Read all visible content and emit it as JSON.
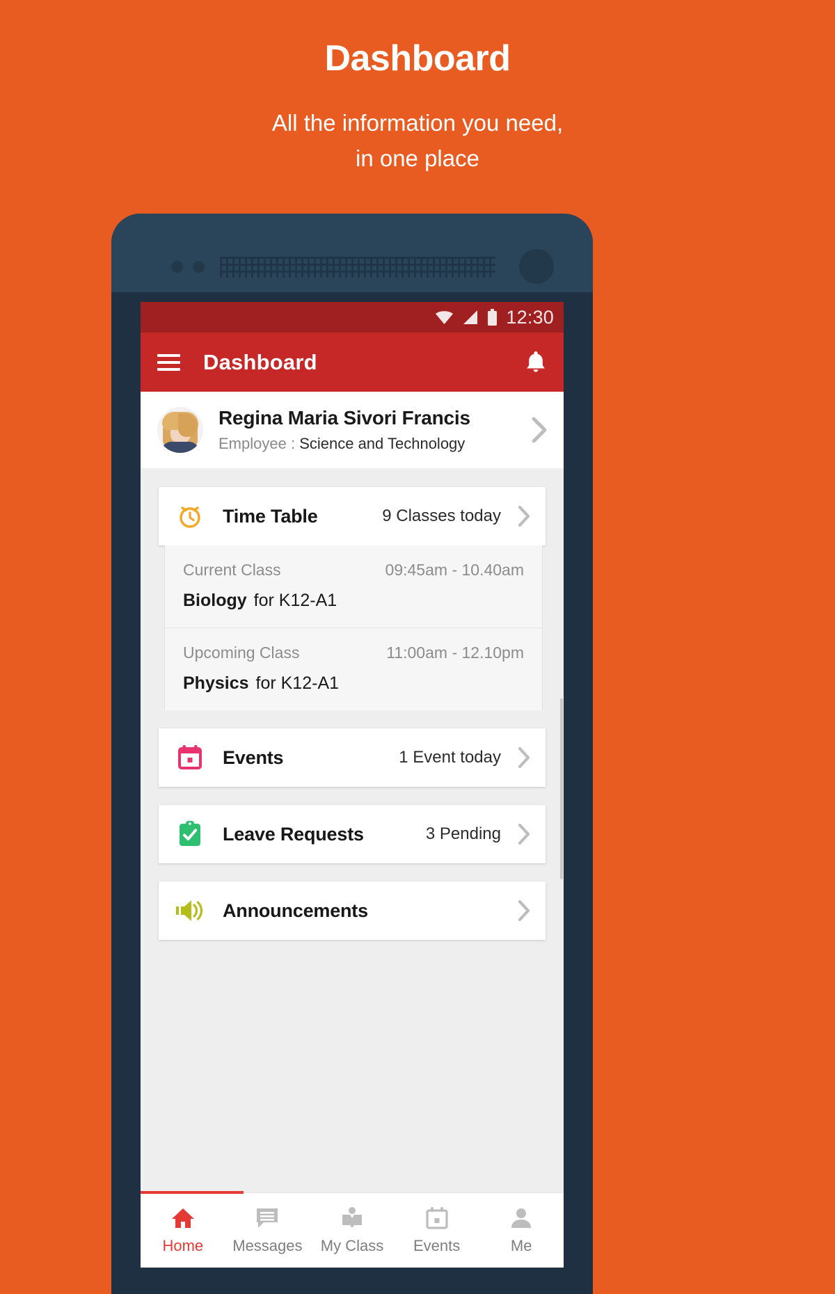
{
  "promo": {
    "title": "Dashboard",
    "subtitle_line1": "All the information you need,",
    "subtitle_line2": "in one place"
  },
  "colors": {
    "background": "#E85C22",
    "phone_body": "#1F3043",
    "appbar": "#C62828",
    "statusbar": "#A01F20",
    "accent_red": "#E53935",
    "timetable_icon": "#F5A623",
    "events_icon": "#E8336E",
    "leave_icon": "#2FBF71",
    "announcements_icon": "#B5BD18"
  },
  "statusbar": {
    "time": "12:30",
    "icons": [
      "wifi-icon",
      "cell-signal-icon",
      "battery-icon"
    ]
  },
  "appbar": {
    "menu_icon": "hamburger-menu-icon",
    "title": "Dashboard",
    "notification_icon": "bell-icon"
  },
  "profile": {
    "avatar": "user-avatar",
    "name": "Regina Maria Sivori Francis",
    "role_label": "Employee :",
    "department": "Science and Technology",
    "chevron": "chevron-right-icon"
  },
  "cards": [
    {
      "id": "time-table",
      "icon": "alarm-clock-icon",
      "title": "Time Table",
      "meta": "9 Classes today",
      "chevron": "chevron-right-icon"
    },
    {
      "id": "events",
      "icon": "calendar-icon",
      "title": "Events",
      "meta": "1 Event today",
      "chevron": "chevron-right-icon"
    },
    {
      "id": "leave-requests",
      "icon": "clipboard-check-icon",
      "title": "Leave Requests",
      "meta": "3 Pending",
      "chevron": "chevron-right-icon"
    },
    {
      "id": "announcements",
      "icon": "megaphone-icon",
      "title": "Announcements",
      "meta": "",
      "chevron": "chevron-right-icon"
    }
  ],
  "timetable_detail": [
    {
      "label": "Current Class",
      "time": "09:45am - 10.40am",
      "subject": "Biology",
      "for": "for K12-A1"
    },
    {
      "label": "Upcoming Class",
      "time": "11:00am - 12.10pm",
      "subject": "Physics",
      "for": "for K12-A1"
    }
  ],
  "bottom_nav": [
    {
      "icon": "home-icon",
      "label": "Home",
      "active": true
    },
    {
      "icon": "message-icon",
      "label": "Messages",
      "active": false
    },
    {
      "icon": "book-icon",
      "label": "My Class",
      "active": false
    },
    {
      "icon": "calendar-icon",
      "label": "Events",
      "active": false
    },
    {
      "icon": "person-icon",
      "label": "Me",
      "active": false
    }
  ]
}
